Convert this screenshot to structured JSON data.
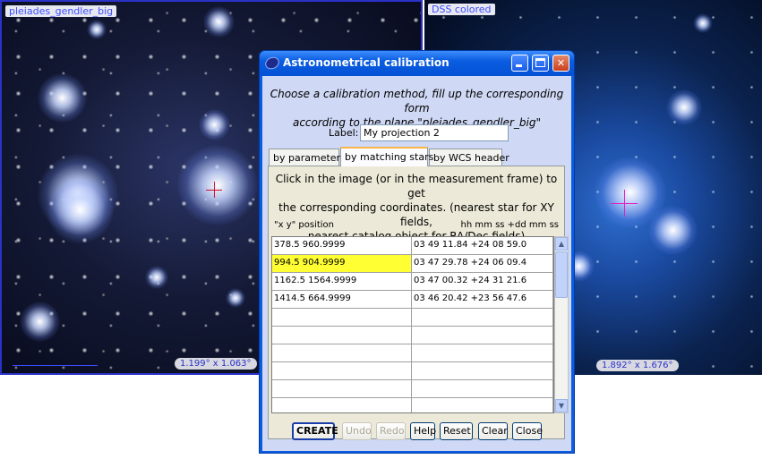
{
  "left_view": {
    "label": "pleiades_gendler_big",
    "size": "1.199° x 1.063°"
  },
  "right_view": {
    "label": "DSS colored",
    "size": "1.892° x 1.676°"
  },
  "dialog": {
    "title": "Astronometrical calibration",
    "instructions_line1": "Choose a calibration method, fill up the corresponding form",
    "instructions_line2": "according to the plane \"pleiades_gendler_big\"",
    "label_caption": "Label:",
    "label_value": "My projection 2",
    "tabs": [
      {
        "label": "by parameters"
      },
      {
        "label": "by matching stars"
      },
      {
        "label": "by WCS header"
      }
    ],
    "active_tab": "by matching stars",
    "tab_description_line1": "Click in the image (or in the measurement frame) to get",
    "tab_description_line2": "the corresponding coordinates. (nearest star for XY fields,",
    "tab_description_line3": "nearest catalog object for RA/Dec fields)",
    "col_xy_header": "\"x y\" position",
    "col_radec_header": "hh mm ss +dd mm ss",
    "rows": [
      {
        "xy": "378.5 960.9999",
        "radec": "03 49 11.84 +24 08 59.0"
      },
      {
        "xy": "994.5 904.9999",
        "radec": "03 47 29.78 +24 06 09.4"
      },
      {
        "xy": "1162.5 1564.9999",
        "radec": "03 47 00.32 +24 31 21.6"
      },
      {
        "xy": "1414.5 664.9999",
        "radec": "03 46 20.42 +23 56 47.6"
      },
      {
        "xy": "",
        "radec": ""
      },
      {
        "xy": "",
        "radec": ""
      },
      {
        "xy": "",
        "radec": ""
      },
      {
        "xy": "",
        "radec": ""
      },
      {
        "xy": "",
        "radec": ""
      },
      {
        "xy": "",
        "radec": ""
      }
    ],
    "buttons": {
      "create": "CREATE",
      "undo": "Undo",
      "redo": "Redo",
      "help": "Help",
      "reset": "Reset",
      "clear": "Clear",
      "close": "Close"
    }
  },
  "colors": {
    "titlebar": "#0a5ce0",
    "dialog_bg": "#cfd8f4",
    "highlight": "#ffff33",
    "view_border": "#2a32c8"
  }
}
